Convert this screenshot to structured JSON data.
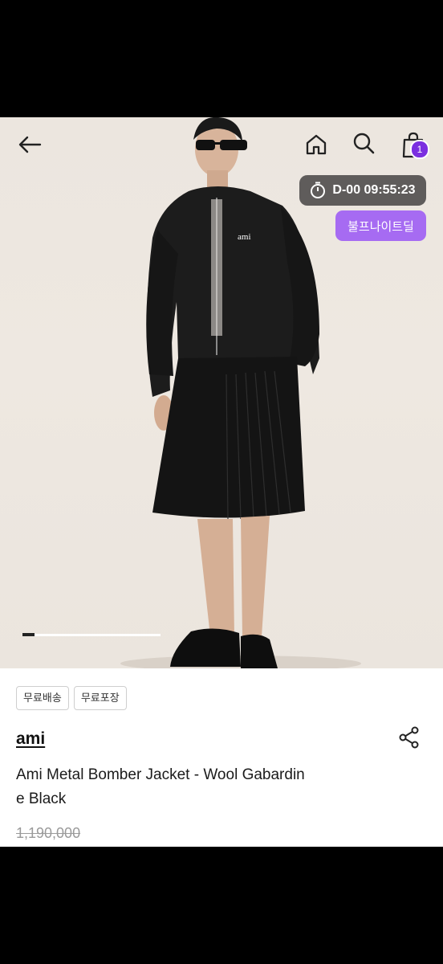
{
  "header": {
    "back_icon": "arrow-left-icon",
    "home_icon": "home-icon",
    "search_icon": "search-icon",
    "cart_icon": "shopping-bag-icon",
    "cart_count": "1"
  },
  "promo": {
    "timer_icon": "stopwatch-icon",
    "countdown": "D-00 09:55:23",
    "deal_label": "불프나이트딜"
  },
  "gallery": {
    "progress": 0.09,
    "jacket_logo": "ami"
  },
  "product": {
    "tags": [
      "무료배송",
      "무료포장"
    ],
    "brand": "ami",
    "share_icon": "share-icon",
    "title_line1": "Ami Metal Bomber Jacket - Wool Gabardin",
    "title_line2": "e Black",
    "original_price": "1,190,000"
  },
  "colors": {
    "accent_purple": "#a66bf2",
    "badge_purple": "#7b2fe0",
    "timer_bg": "#5f5c5b"
  }
}
